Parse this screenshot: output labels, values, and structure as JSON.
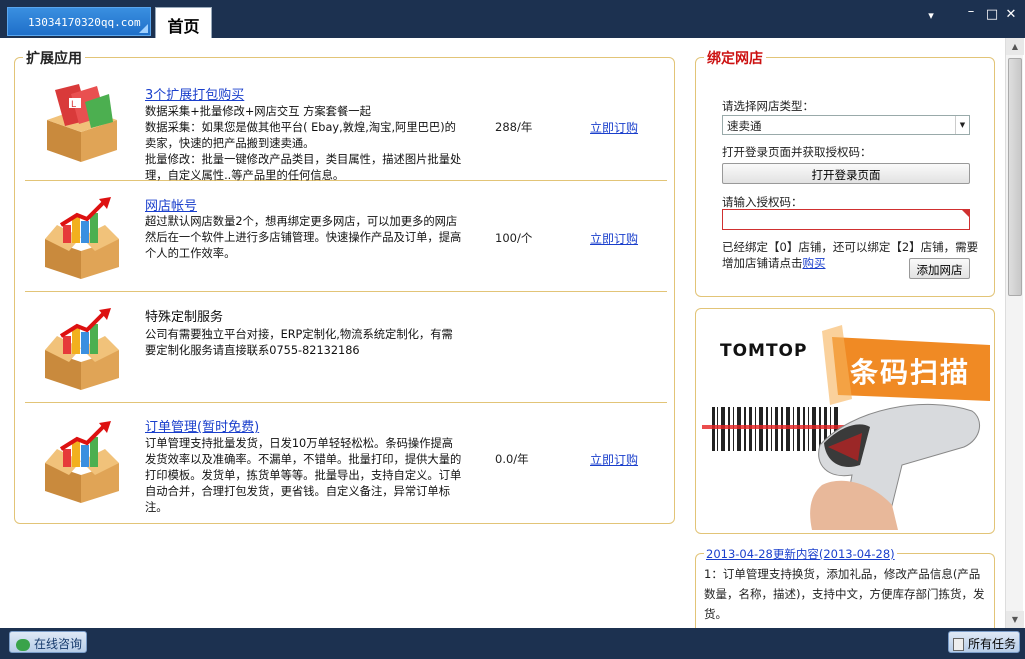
{
  "titlebar": {
    "account": "13034170320qq.com",
    "home_tab": "首页",
    "controls": {
      "menu": "▾",
      "minimize": "–",
      "maximize": "□",
      "close": "✕"
    }
  },
  "extensions": {
    "legend": "扩展应用",
    "rows": [
      {
        "title": "3个扩展打包购买",
        "desc": "数据采集+批量修改+网店交互 方案套餐一起\n  数据采集：如果您是做其他平台( Ebay,敦煌,淘宝,阿里巴巴)的卖家，快速的把产品搬到速卖通。\n  批量修改：批量一键修改产品类目，类目属性，描述图片批量处理，自定义属性..等产品里的任何信息。",
        "price": "288/年",
        "action": "立即订购"
      },
      {
        "title": "网店帐号",
        "desc": "超过默认网店数量2个，想再绑定更多网店，可以加更多的网店然后在一个软件上进行多店铺管理。快速操作产品及订单，提高个人的工作效率。",
        "price": "100/个",
        "action": "立即订购"
      },
      {
        "title": "特殊定制服务",
        "desc": "公司有需要独立平台对接，ERP定制化,物流系统定制化，有需要定制化服务请直接联系0755-82132186",
        "price": "",
        "action": ""
      },
      {
        "title": "订单管理(暂时免费)",
        "desc": "订单管理支持批量发货，日发10万单轻轻松松。条码操作提高发货效率以及准确率。不漏单，不错单。批量打印，提供大量的打印模板。发货单，拣货单等等。批量导出，支持自定义。订单自动合并，合理打包发货，更省钱。自定义备注，异常订单标注。",
        "price": "0.0/年",
        "action": "立即订购"
      }
    ]
  },
  "bind_shop": {
    "legend": "绑定网店",
    "type_label": "请选择网店类型：",
    "type_value": "速卖通",
    "login_label": "打开登录页面并获取授权码：",
    "login_button": "打开登录页面",
    "code_label": "请输入授权码：",
    "code_value": "",
    "info_text": "已经绑定【0】店铺，还可以绑定【2】店铺，需要增加店铺请点击",
    "buy_link": "购买",
    "add_button": "添加网店"
  },
  "ad": {
    "brand": "TOMTOP",
    "headline": "条码扫描"
  },
  "news": {
    "title": "2013-04-28更新内容(2013-04-28)",
    "text": "1：订单管理支持换货，添加礼品，修改产品信息(产品数量，名称，描述)，支持中文，方便库存部门拣货，发货。"
  },
  "statusbar": {
    "consult": "在线咨询",
    "tasks": "所有任务"
  },
  "colors": {
    "frame": "#1c3150",
    "panel_border": "#e2c477",
    "link": "#1a3fcc",
    "bind_legend": "#cc1111"
  }
}
